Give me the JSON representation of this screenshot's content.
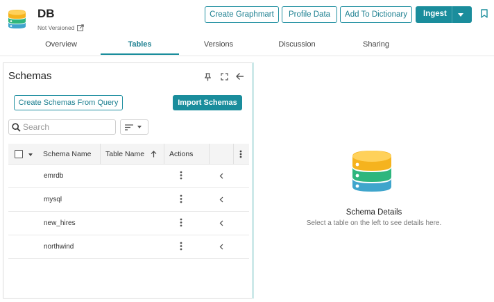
{
  "header": {
    "title": "DB",
    "version_status": "Not Versioned",
    "actions": {
      "create_graphmart": "Create Graphmart",
      "profile_data": "Profile Data",
      "add_to_dictionary": "Add To Dictionary",
      "ingest": "Ingest"
    },
    "tabs": [
      "Overview",
      "Tables",
      "Versions",
      "Discussion",
      "Sharing"
    ],
    "active_tab": "Tables"
  },
  "schemas_panel": {
    "title": "Schemas",
    "create_from_query": "Create Schemas From Query",
    "import_schemas": "Import Schemas",
    "search_placeholder": "Search",
    "columns": {
      "schema_name": "Schema Name",
      "table_name": "Table Name",
      "actions": "Actions"
    },
    "rows": [
      {
        "schema_name": "emrdb"
      },
      {
        "schema_name": "mysql"
      },
      {
        "schema_name": "new_hires"
      },
      {
        "schema_name": "northwind"
      }
    ]
  },
  "details_panel": {
    "title": "Schema Details",
    "subtitle": "Select a table on the left to see details here."
  },
  "colors": {
    "accent": "#1a8d9c",
    "db_icon_top": "#f5b31e",
    "db_icon_mid": "#2eb67d",
    "db_icon_bottom": "#3fa5cc"
  }
}
